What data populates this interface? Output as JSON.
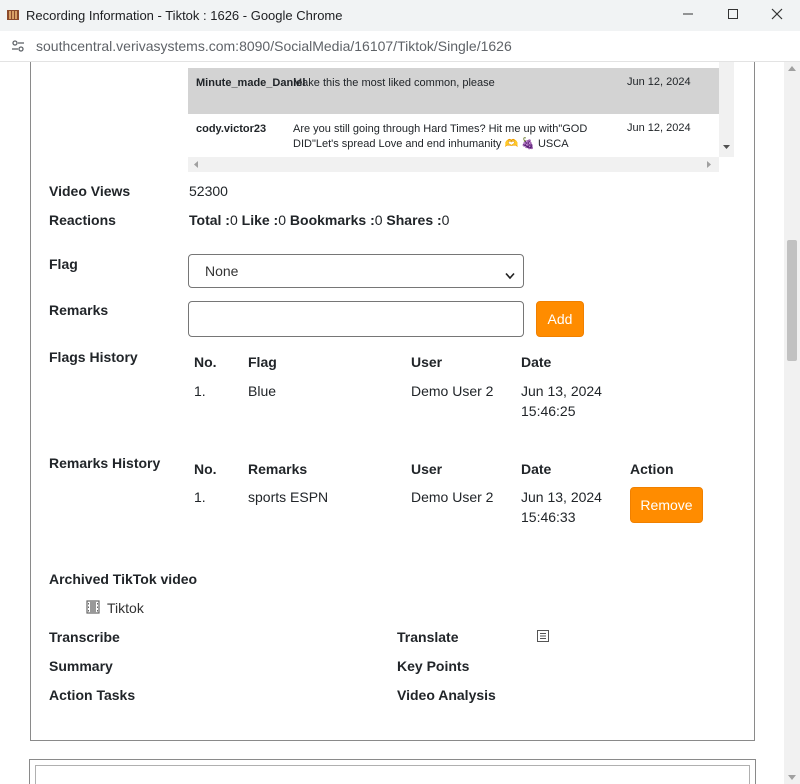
{
  "window": {
    "title": "Recording Information - Tiktok : 1626 - Google Chrome",
    "url": "southcentral.verivasystems.com:8090/SocialMedia/16107/Tiktok/Single/1626"
  },
  "comments": [
    {
      "user": "Minute_made_Daniel",
      "text": "Make this the most liked common, please",
      "date": "Jun 12, 2024"
    },
    {
      "user": "cody.victor23",
      "text": "Are you still going through Hard Times? Hit me up with\"GOD DID\"Let's spread Love and end inhumanity 🫶 🍇 USCA",
      "date": "Jun 12, 2024"
    }
  ],
  "video_views": {
    "label": "Video Views",
    "value": "52300"
  },
  "reactions": {
    "label": "Reactions",
    "total_label": "Total :",
    "total": "0",
    "like_label": "Like :",
    "like": "0",
    "bookmarks_label": "Bookmarks :",
    "bookmarks": "0",
    "shares_label": "Shares :",
    "shares": "0"
  },
  "flag": {
    "label": "Flag",
    "selected": "None"
  },
  "remarks": {
    "label": "Remarks",
    "value": "",
    "add_label": "Add"
  },
  "flags_history": {
    "label": "Flags History",
    "headers": [
      "No.",
      "Flag",
      "User",
      "Date"
    ],
    "rows": [
      {
        "no": "1.",
        "flag": "Blue",
        "user": "Demo User 2",
        "date": "Jun 13, 2024",
        "time": "15:46:25"
      }
    ]
  },
  "remarks_history": {
    "label": "Remarks History",
    "headers": [
      "No.",
      "Remarks",
      "User",
      "Date",
      "Action"
    ],
    "rows": [
      {
        "no": "1.",
        "remarks": "sports ESPN",
        "user": "Demo User 2",
        "date": "Jun 13, 2024",
        "time": "15:46:33",
        "action": "Remove"
      }
    ]
  },
  "archived": {
    "label": "Archived TikTok video",
    "link": "Tiktok"
  },
  "tools": {
    "transcribe": "Transcribe",
    "translate": "Translate",
    "summary": "Summary",
    "key_points": "Key Points",
    "action_tasks": "Action Tasks",
    "video_analysis": "Video Analysis"
  },
  "colors": {
    "accent": "#ff8c00",
    "selected_row": "#d3d3d3"
  },
  "icons": [
    "app-icon",
    "site-info-icon",
    "minimize-icon",
    "maximize-icon",
    "close-icon",
    "chevron-down-icon",
    "film-icon",
    "document-icon"
  ]
}
